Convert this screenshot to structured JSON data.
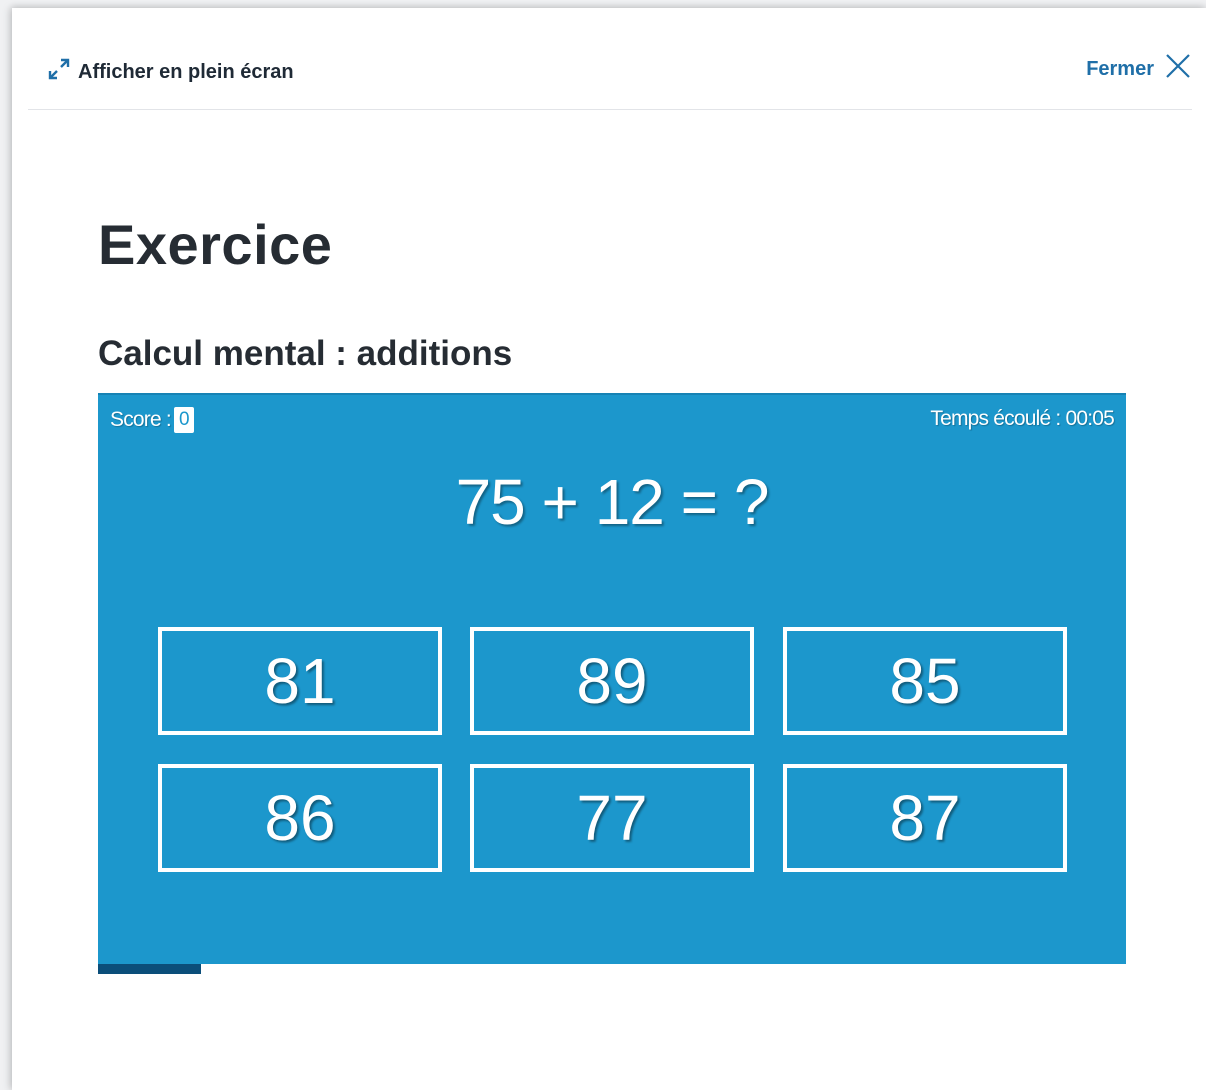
{
  "header": {
    "fullscreen_label": "Afficher en plein écran",
    "fullscreen_icon": "expand-arrows-icon",
    "close_label": "Fermer",
    "close_icon": "close-x-icon"
  },
  "page_title": "Exercice",
  "exercise": {
    "title": "Calcul mental : additions",
    "score_label": "Score :",
    "score_value": "0",
    "timer_text": "Temps écoulé : 00:05",
    "question": "75 + 12 = ?",
    "answers": [
      "81",
      "89",
      "85",
      "86",
      "77",
      "87"
    ],
    "progress_fraction": 0.1
  },
  "colors": {
    "game_background": "#1c97cc",
    "accent_link": "#1f6fa8",
    "progress_fill": "#0b4e7a",
    "title_text": "#262c33"
  }
}
